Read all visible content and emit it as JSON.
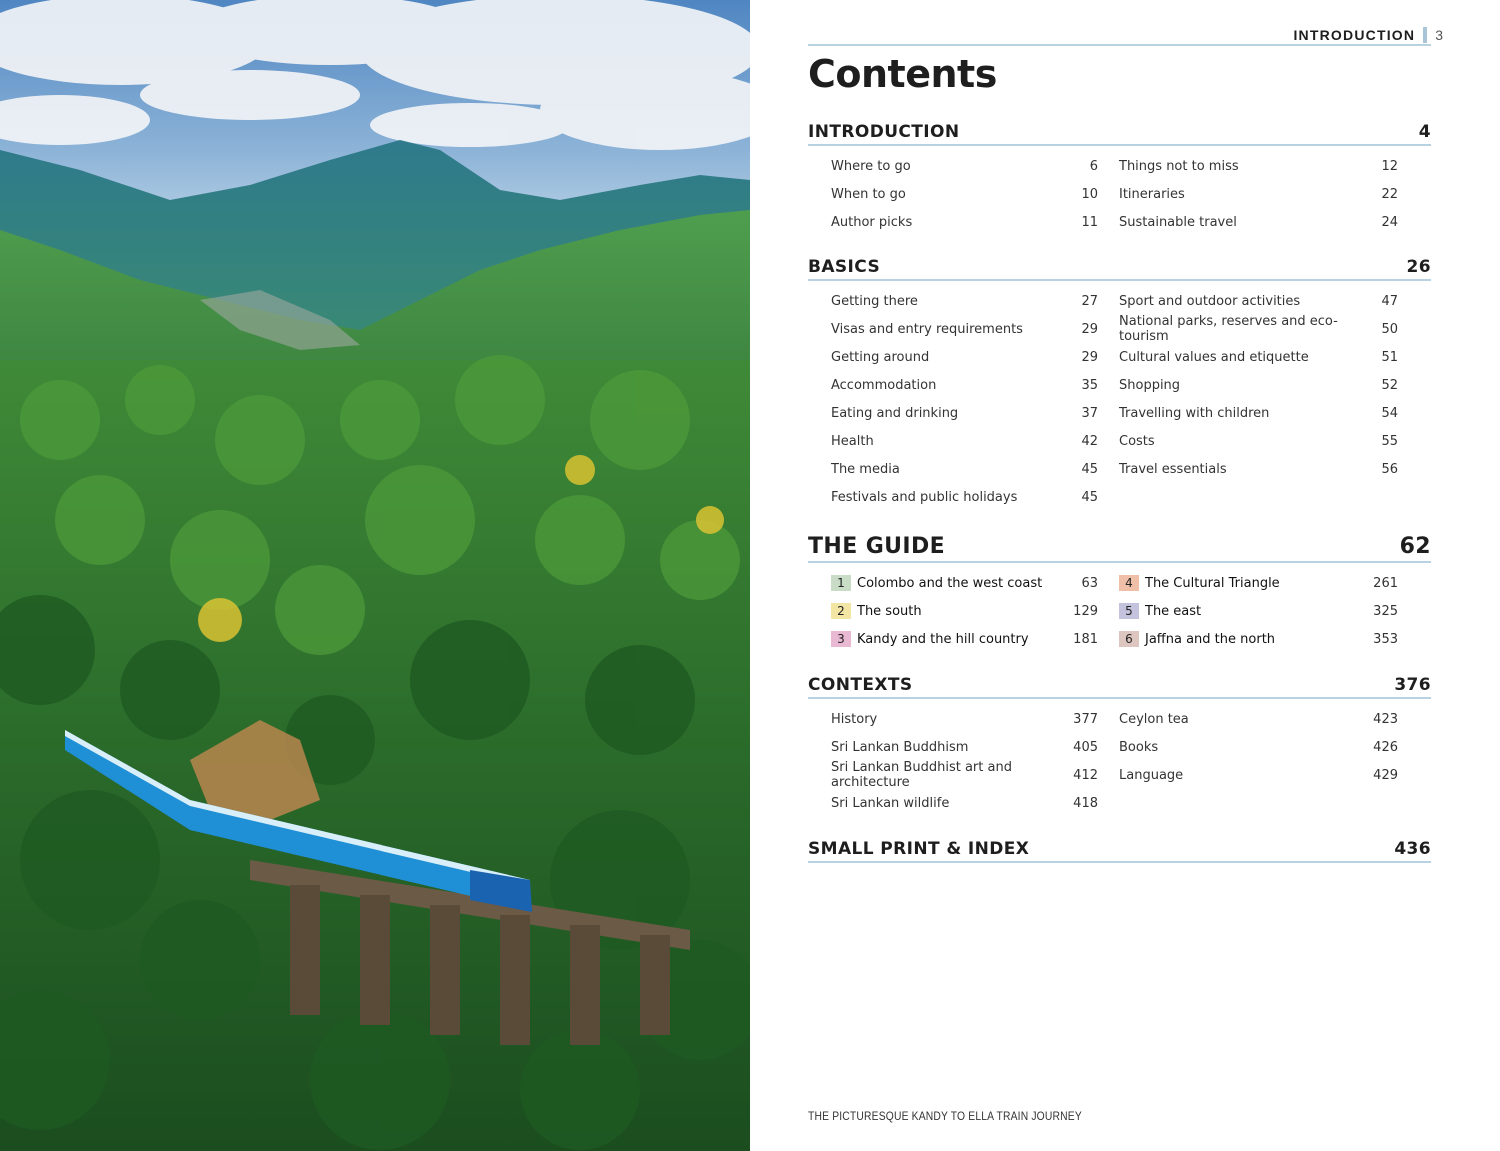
{
  "running_head": {
    "label": "INTRODUCTION",
    "page": "3"
  },
  "title": "Contents",
  "sections": [
    {
      "name": "INTRODUCTION",
      "page": "4",
      "left": [
        {
          "label": "Where to go",
          "page": "6"
        },
        {
          "label": "When to go",
          "page": "10"
        },
        {
          "label": "Author picks",
          "page": "11"
        }
      ],
      "right": [
        {
          "label": "Things not to miss",
          "page": "12"
        },
        {
          "label": "Itineraries",
          "page": "22"
        },
        {
          "label": "Sustainable travel",
          "page": "24"
        }
      ]
    },
    {
      "name": "BASICS",
      "page": "26",
      "left": [
        {
          "label": "Getting there",
          "page": "27"
        },
        {
          "label": "Visas and entry requirements",
          "page": "29"
        },
        {
          "label": "Getting around",
          "page": "29"
        },
        {
          "label": "Accommodation",
          "page": "35"
        },
        {
          "label": "Eating and drinking",
          "page": "37"
        },
        {
          "label": "Health",
          "page": "42"
        },
        {
          "label": "The media",
          "page": "45"
        },
        {
          "label": "Festivals and public holidays",
          "page": "45"
        }
      ],
      "right": [
        {
          "label": "Sport and outdoor activities",
          "page": "47"
        },
        {
          "label": "National parks, reserves and eco-tourism",
          "page": "50"
        },
        {
          "label": "Cultural values and etiquette",
          "page": "51"
        },
        {
          "label": "Shopping",
          "page": "52"
        },
        {
          "label": "Travelling with children",
          "page": "54"
        },
        {
          "label": "Costs",
          "page": "55"
        },
        {
          "label": "Travel essentials",
          "page": "56"
        }
      ]
    },
    {
      "name": "THE GUIDE",
      "page": "62",
      "left": [
        {
          "num": "1",
          "label": "Colombo and the west coast",
          "page": "63",
          "color": "#c9dcc6"
        },
        {
          "num": "2",
          "label": "The south",
          "page": "129",
          "color": "#f3e6a4"
        },
        {
          "num": "3",
          "label": "Kandy and the hill country",
          "page": "181",
          "color": "#e9b8d2"
        }
      ],
      "right": [
        {
          "num": "4",
          "label": "The Cultural Triangle",
          "page": "261",
          "color": "#f0bfa8"
        },
        {
          "num": "5",
          "label": "The east",
          "page": "325",
          "color": "#c3c3dd"
        },
        {
          "num": "6",
          "label": "Jaffna and the north",
          "page": "353",
          "color": "#dcc6bf"
        }
      ]
    },
    {
      "name": "CONTEXTS",
      "page": "376",
      "left": [
        {
          "label": "History",
          "page": "377"
        },
        {
          "label": "Sri Lankan Buddhism",
          "page": "405"
        },
        {
          "label": "Sri Lankan Buddhist art and architecture",
          "page": "412"
        },
        {
          "label": "Sri Lankan wildlife",
          "page": "418"
        }
      ],
      "right": [
        {
          "label": "Ceylon tea",
          "page": "423"
        },
        {
          "label": "Books",
          "page": "426"
        },
        {
          "label": "Language",
          "page": "429"
        }
      ]
    },
    {
      "name": "SMALL PRINT & INDEX",
      "page": "436",
      "left": [],
      "right": []
    }
  ],
  "caption": "THE PICTURESQUE KANDY TO ELLA TRAIN JOURNEY"
}
